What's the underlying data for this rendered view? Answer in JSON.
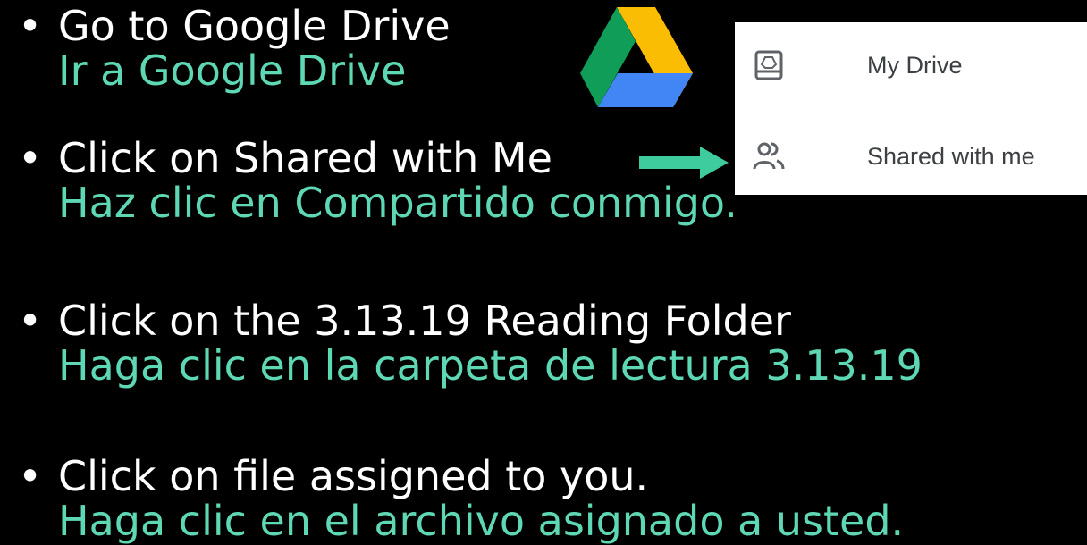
{
  "colors": {
    "background": "#000000",
    "english_text": "#ffffff",
    "spanish_text": "#5ed8b4",
    "arrow": "#3ecb9d",
    "panel_background": "#ffffff",
    "panel_text": "#3c4043"
  },
  "bullets": [
    {
      "marker": "•",
      "en": "Go to Google Drive",
      "es": "Ir a Google Drive"
    },
    {
      "marker": "•",
      "en": "Click on Shared with Me",
      "es": "Haz clic en Compartido conmigo."
    },
    {
      "marker": "•",
      "en": "Click on the 3.13.19 Reading Folder",
      "es": "Haga clic en la carpeta de lectura 3.13.19"
    },
    {
      "marker": "•",
      "en": "Click on file assigned to you.",
      "es": "Haga clic en el archivo asignado a usted."
    }
  ],
  "logo": {
    "icon": "google-drive-logo"
  },
  "pointer": {
    "icon": "right-arrow-icon"
  },
  "drive_menu": {
    "items": [
      {
        "label": "My Drive",
        "icon": "my-drive-icon"
      },
      {
        "label": "Shared with me",
        "icon": "shared-with-me-icon"
      }
    ]
  }
}
